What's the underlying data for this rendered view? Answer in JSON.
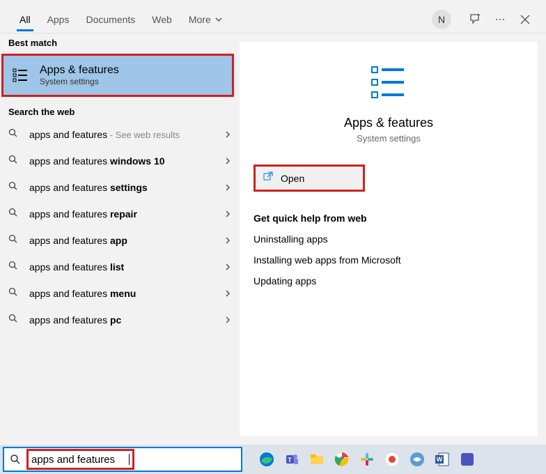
{
  "tabs": {
    "all": "All",
    "apps": "Apps",
    "documents": "Documents",
    "web": "Web",
    "more": "More"
  },
  "user_initial": "N",
  "left": {
    "best_match_label": "Best match",
    "best_match_title": "Apps & features",
    "best_match_sub": "System settings",
    "search_web_label": "Search the web",
    "items": [
      {
        "prefix": "apps and features",
        "bold": "",
        "suffix": " - See web results",
        "has_suffix": true
      },
      {
        "prefix": "apps and features ",
        "bold": "windows 10",
        "suffix": "",
        "has_suffix": false
      },
      {
        "prefix": "apps and features ",
        "bold": "settings",
        "suffix": "",
        "has_suffix": false
      },
      {
        "prefix": "apps and features ",
        "bold": "repair",
        "suffix": "",
        "has_suffix": false
      },
      {
        "prefix": "apps and features ",
        "bold": "app",
        "suffix": "",
        "has_suffix": false
      },
      {
        "prefix": "apps and features ",
        "bold": "list",
        "suffix": "",
        "has_suffix": false
      },
      {
        "prefix": "apps and features ",
        "bold": "menu",
        "suffix": "",
        "has_suffix": false
      },
      {
        "prefix": "apps and features ",
        "bold": "pc",
        "suffix": "",
        "has_suffix": false
      }
    ]
  },
  "right": {
    "title": "Apps & features",
    "sub": "System settings",
    "open_label": "Open",
    "help_label": "Get quick help from web",
    "help_items": [
      "Uninstalling apps",
      "Installing web apps from Microsoft",
      "Updating apps"
    ]
  },
  "search": {
    "value": "apps and features"
  }
}
